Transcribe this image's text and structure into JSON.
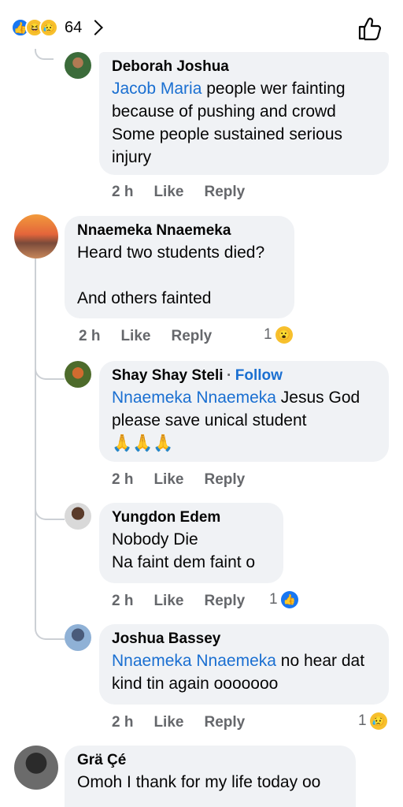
{
  "header": {
    "reaction_icons": [
      "like-icon",
      "haha-icon",
      "sad-icon"
    ],
    "reaction_count": "64"
  },
  "actions": {
    "like": "Like",
    "reply": "Reply"
  },
  "comments": [
    {
      "name": "Deborah Joshua",
      "mention": "Jacob Maria",
      "text": " people wer fainting because of pushing and crowd Some people sustained serious injury",
      "time": "2 h"
    },
    {
      "name": "Nnaemeka Nnaemeka",
      "line1": "Heard two students died?",
      "line2": "And others fainted",
      "time": "2 h",
      "reaction_count": "1",
      "reaction_icon": "wow-icon"
    },
    {
      "name": "Shay Shay Steli",
      "follow": "Follow",
      "separator": "·",
      "mention": "Nnaemeka Nnaemeka",
      "text": " Jesus God please save unical student",
      "emoji": "🙏🙏🙏",
      "time": "2 h"
    },
    {
      "name": "Yungdon Edem",
      "line1": "Nobody Die",
      "line2": "Na faint dem faint o",
      "time": "2 h",
      "reaction_count": "1",
      "reaction_icon": "like-icon"
    },
    {
      "name": "Joshua Bassey",
      "mention": "Nnaemeka Nnaemeka",
      "text": " no hear dat kind tin again ooooooo",
      "time": "2 h",
      "reaction_count": "1",
      "reaction_icon": "sad-icon"
    },
    {
      "name": "Grä Çé",
      "text": "Omoh I thank for my life today oo"
    }
  ],
  "colors": {
    "link": "#1a6fd1",
    "bubble": "#f0f2f5",
    "meta": "#65676b",
    "like_blue": "#1877f2"
  }
}
